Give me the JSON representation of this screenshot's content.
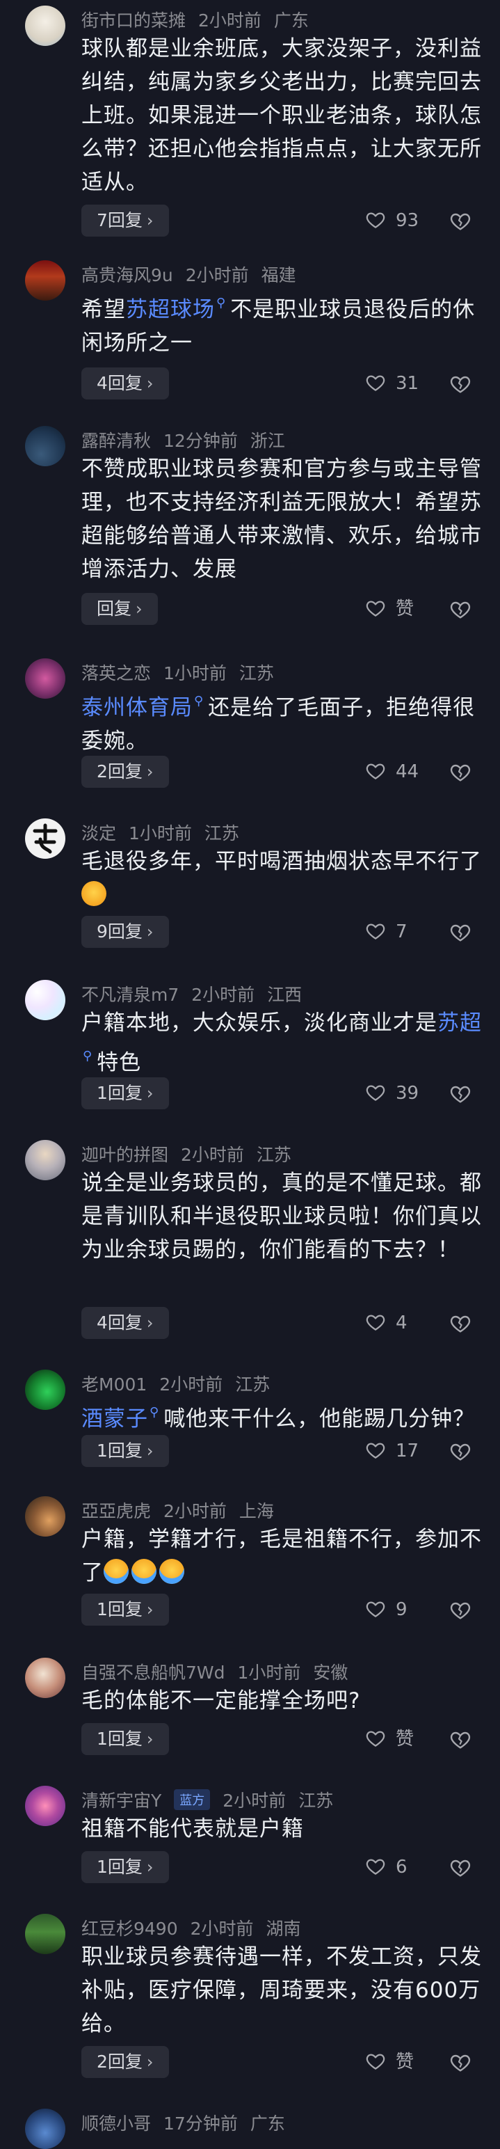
{
  "icons": {
    "heart": "heart-outline-icon",
    "dislike": "broken-heart-icon",
    "chevron": "chevron-right-icon",
    "search": "search-icon"
  },
  "colors": {
    "background": "#161823",
    "link": "#5a8bff",
    "meta": "#8a8b91",
    "reply_bg": "#2a2c37"
  },
  "comments": [
    {
      "user": "街市口的菜摊",
      "time": "2小时前",
      "location": "广东",
      "text": "球队都是业余班底，大家没架子，没利益纠结，纯属为家乡父老出力，比赛完回去上班。如果混进一个职业老油条，球队怎么带？还担心他会指指点点，让大家无所适从。",
      "replies": "7回复",
      "likes": "93"
    },
    {
      "user": "高贵海风9u",
      "time": "2小时前",
      "location": "福建",
      "text_pre": "希望",
      "link": "苏超球场",
      "text_post": "不是职业球员退役后的休闲场所之一",
      "replies": "4回复",
      "likes": "31"
    },
    {
      "user": "露醉清秋",
      "time": "12分钟前",
      "location": "浙江",
      "text": "不赞成职业球员参赛和官方参与或主导管理，也不支持经济利益无限放大！希望苏超能够给普通人带来激情、欢乐，给城市增添活力、发展",
      "replies": "回复",
      "likes": "赞"
    },
    {
      "user": "落英之恋",
      "time": "1小时前",
      "location": "江苏",
      "link": "泰州体育局",
      "text_post": "还是给了毛面子，拒绝得很委婉。",
      "replies": "2回复",
      "likes": "44"
    },
    {
      "user": "淡定",
      "time": "1小时前",
      "location": "江苏",
      "text": "毛退役多年，平时喝酒抽烟状态早不行了",
      "replies": "9回复",
      "likes": "7"
    },
    {
      "user": "不凡清泉m7",
      "time": "2小时前",
      "location": "江西",
      "text_pre": "户籍本地，大众娱乐，淡化商业才是",
      "link": "苏超",
      "text_post": "特色",
      "replies": "1回复",
      "likes": "39"
    },
    {
      "user": "迦叶的拼图",
      "time": "2小时前",
      "location": "江苏",
      "text": "说全是业务球员的，真的是不懂足球。都是青训队和半退役职业球员啦！你们真以为业余球员踢的，你们能看的下去？！",
      "replies": "4回复",
      "likes": "4"
    },
    {
      "user": "老M001",
      "time": "2小时前",
      "location": "江苏",
      "link": "酒蒙子",
      "text_post": "喊他来干什么，他能踢几分钟？",
      "replies": "1回复",
      "likes": "17"
    },
    {
      "user": "亞亞虎虎",
      "time": "2小时前",
      "location": "上海",
      "text": "户籍，学籍才行，毛是祖籍不行，参加不了",
      "replies": "1回复",
      "likes": "9"
    },
    {
      "user": "自强不息船帆7Wd",
      "time": "1小时前",
      "location": "安徽",
      "text": "毛的体能不一定能撑全场吧?",
      "replies": "1回复",
      "likes": "赞"
    },
    {
      "user": "清新宇宙Y",
      "badge": "蓝方",
      "time": "2小时前",
      "location": "江苏",
      "text": "祖籍不能代表就是户籍",
      "replies": "1回复",
      "likes": "6"
    },
    {
      "user": "红豆杉9490",
      "time": "2小时前",
      "location": "湖南",
      "text": "职业球员参赛待遇一样，不发工资，只发补贴，医疗保障，周琦要来，没有600万给。",
      "replies": "2回复",
      "likes": "赞"
    },
    {
      "user": "顺德小哥",
      "time": "17分钟前",
      "location": "广东"
    }
  ]
}
